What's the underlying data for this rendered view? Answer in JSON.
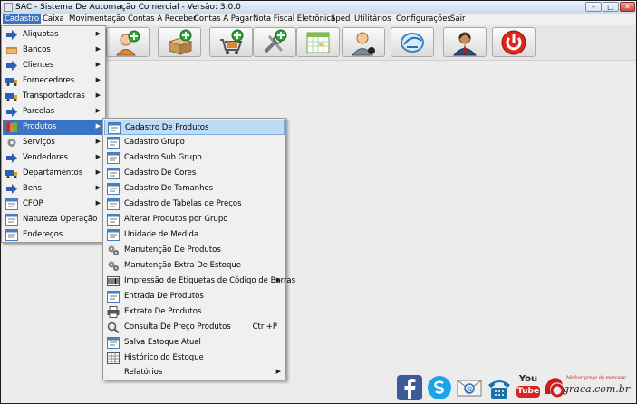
{
  "window": {
    "title": "SAC - Sistema De Automação Comercial - Versão: 3.0.0",
    "controls": {
      "minimize": "–",
      "maximize": "□",
      "close": "✕"
    }
  },
  "menubar": [
    {
      "label": "Cadastro",
      "active": true
    },
    {
      "label": "Caixa"
    },
    {
      "label": "Movimentação"
    },
    {
      "label": "Contas A Receber"
    },
    {
      "label": "Contas A Pagar"
    },
    {
      "label": "Nota Fiscal Eletrônica"
    },
    {
      "label": "Sped"
    },
    {
      "label": "Utilitários"
    },
    {
      "label": "Configurações"
    },
    {
      "label": "Sair"
    }
  ],
  "toolbar": [
    {
      "icon": "add-client-icon"
    },
    {
      "icon": "add-product-box-icon"
    },
    {
      "icon": "add-sale-cart-icon"
    },
    {
      "icon": "service-tools-icon"
    },
    {
      "icon": "calendar-icon"
    },
    {
      "icon": "user-icon"
    },
    {
      "icon": "nfe-icon"
    },
    {
      "icon": "support-agent-icon"
    },
    {
      "icon": "power-icon"
    }
  ],
  "cadastro_menu": {
    "items": [
      {
        "label": "Aliquotas",
        "icon": "arrow-right-icon",
        "submenu": true
      },
      {
        "label": "Bancos",
        "icon": "bank-icon",
        "submenu": true
      },
      {
        "label": "Clientes",
        "icon": "arrow-right-icon",
        "submenu": true
      },
      {
        "label": "Fornecedores",
        "icon": "truck-icon",
        "submenu": true
      },
      {
        "label": "Transportadoras",
        "icon": "truck-icon",
        "submenu": true
      },
      {
        "label": "Parcelas",
        "icon": "arrow-right-icon",
        "submenu": true
      },
      {
        "label": "Produtos",
        "icon": "books-icon",
        "submenu": true,
        "active": true
      },
      {
        "label": "Serviços",
        "icon": "gear-icon",
        "submenu": true
      },
      {
        "label": "Vendedores",
        "icon": "arrow-right-icon",
        "submenu": true
      },
      {
        "label": "Departamentos",
        "icon": "truck-icon",
        "submenu": true
      },
      {
        "label": "Bens",
        "icon": "arrow-right-icon",
        "submenu": true
      },
      {
        "label": "CFOP",
        "icon": "form-icon",
        "submenu": true
      },
      {
        "label": "Natureza Operação",
        "icon": "form-icon",
        "submenu": false
      },
      {
        "label": "Endereços",
        "icon": "form-icon",
        "submenu": false
      }
    ]
  },
  "produtos_menu": {
    "items": [
      {
        "label": "Cadastro De Produtos",
        "icon": "form-icon",
        "highlighted": true
      },
      {
        "label": "Cadastro Grupo",
        "icon": "form-icon"
      },
      {
        "label": "Cadastro Sub Grupo",
        "icon": "form-icon"
      },
      {
        "label": "Cadastro De Cores",
        "icon": "form-icon"
      },
      {
        "label": "Cadastro De Tamanhos",
        "icon": "form-icon"
      },
      {
        "label": "Cadastro de Tabelas de Preços",
        "icon": "form-icon"
      },
      {
        "label": "Alterar Produtos por Grupo",
        "icon": "form-icon"
      },
      {
        "label": "Unidade de Medida",
        "icon": "form-icon"
      },
      {
        "label": "Manutenção De Produtos",
        "icon": "gears-icon"
      },
      {
        "label": "Manutenção Extra De Estoque",
        "icon": "gears-icon"
      },
      {
        "label": "Impressão de Etiquetas de Código de Barras",
        "icon": "barcode-icon",
        "submenu": true
      },
      {
        "label": "Entrada De Produtos",
        "icon": "form-icon"
      },
      {
        "label": "Extrato De Produtos",
        "icon": "printer-icon"
      },
      {
        "label": "Consulta De Preço Produtos",
        "icon": "magnifier-icon",
        "shortcut": "Ctrl+P"
      },
      {
        "label": "Salva Estoque Atual",
        "icon": "form-icon"
      },
      {
        "label": "Histórico do Estoque",
        "icon": "spreadsheet-icon"
      },
      {
        "label": "Relatórios",
        "icon": "blank-icon",
        "submenu": true
      }
    ]
  },
  "social": {
    "youtube_top": "You",
    "youtube_bottom": "Tube",
    "partner": "graca.com.br",
    "partner_tagline": "Melhor preço do mercado"
  },
  "colors": {
    "menu_highlight": "#bfdcf7",
    "menubar_active": "#3b73c6",
    "power_red": "#e0261c"
  }
}
